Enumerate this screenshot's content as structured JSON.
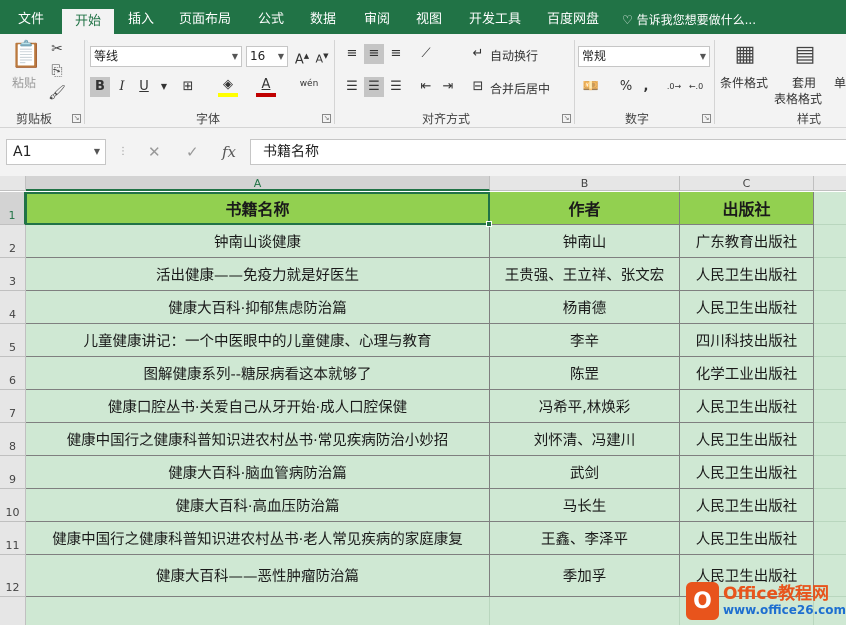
{
  "tabs": [
    {
      "label": "文件"
    },
    {
      "label": "开始"
    },
    {
      "label": "插入"
    },
    {
      "label": "页面布局"
    },
    {
      "label": "公式"
    },
    {
      "label": "数据"
    },
    {
      "label": "审阅"
    },
    {
      "label": "视图"
    },
    {
      "label": "开发工具"
    },
    {
      "label": "百度网盘"
    }
  ],
  "active_tab": "开始",
  "tell_me": "告诉我您想要做什么...",
  "ribbon": {
    "clipboard": {
      "label": "剪贴板",
      "paste": "粘贴"
    },
    "font": {
      "label": "字体",
      "name": "等线",
      "size": "16",
      "bold": "B",
      "italic": "I",
      "underline": "U",
      "wen": "wén"
    },
    "alignment": {
      "label": "对齐方式",
      "wrap": "自动换行",
      "merge": "合并后居中"
    },
    "number": {
      "label": "数字",
      "format": "常规",
      "percent": "%",
      "comma": ","
    },
    "styles": {
      "label": "样式",
      "cond": "条件格式",
      "table_l1": "套用",
      "table_l2": "表格格式",
      "cell": "单"
    }
  },
  "formula_bar": {
    "name_box": "A1",
    "cancel": "✕",
    "enter": "✓",
    "fx": "fx",
    "content": "书籍名称"
  },
  "columns": [
    {
      "label": "A"
    },
    {
      "label": "B"
    },
    {
      "label": "C"
    },
    {
      "label": ""
    }
  ],
  "rows": [
    {
      "n": "1"
    },
    {
      "n": "2"
    },
    {
      "n": "3"
    },
    {
      "n": "4"
    },
    {
      "n": "5"
    },
    {
      "n": "6"
    },
    {
      "n": "7"
    },
    {
      "n": "8"
    },
    {
      "n": "9"
    },
    {
      "n": "10"
    },
    {
      "n": "11"
    },
    {
      "n": "12"
    }
  ],
  "table": {
    "header": [
      "书籍名称",
      "作者",
      "出版社"
    ],
    "rows": [
      [
        "钟南山谈健康",
        "钟南山",
        "广东教育出版社"
      ],
      [
        "活出健康——免疫力就是好医生",
        "王贵强、王立祥、张文宏",
        "人民卫生出版社"
      ],
      [
        "健康大百科·抑郁焦虑防治篇",
        "杨甫德",
        "人民卫生出版社"
      ],
      [
        "儿童健康讲记：一个中医眼中的儿童健康、心理与教育",
        "李辛",
        "四川科技出版社"
      ],
      [
        "图解健康系列--糖尿病看这本就够了",
        "陈罡",
        "化学工业出版社"
      ],
      [
        "健康口腔丛书·关爱自己从牙开始·成人口腔保健",
        "冯希平,林焕彩",
        "人民卫生出版社"
      ],
      [
        "健康中国行之健康科普知识进农村丛书·常见疾病防治小妙招",
        "刘怀清、冯建川",
        "人民卫生出版社"
      ],
      [
        "健康大百科·脑血管病防治篇",
        "武剑",
        "人民卫生出版社"
      ],
      [
        "健康大百科·高血压防治篇",
        "马长生",
        "人民卫生出版社"
      ],
      [
        "健康中国行之健康科普知识进农村丛书·老人常见疾病的家庭康复",
        "王鑫、李泽平",
        "人民卫生出版社"
      ],
      [
        "健康大百科——恶性肿瘤防治篇",
        "季加孚",
        "人民卫生出版社"
      ]
    ]
  },
  "watermark": {
    "logo": "O",
    "line1": "Office教程网",
    "line2": "www.office26.com"
  }
}
